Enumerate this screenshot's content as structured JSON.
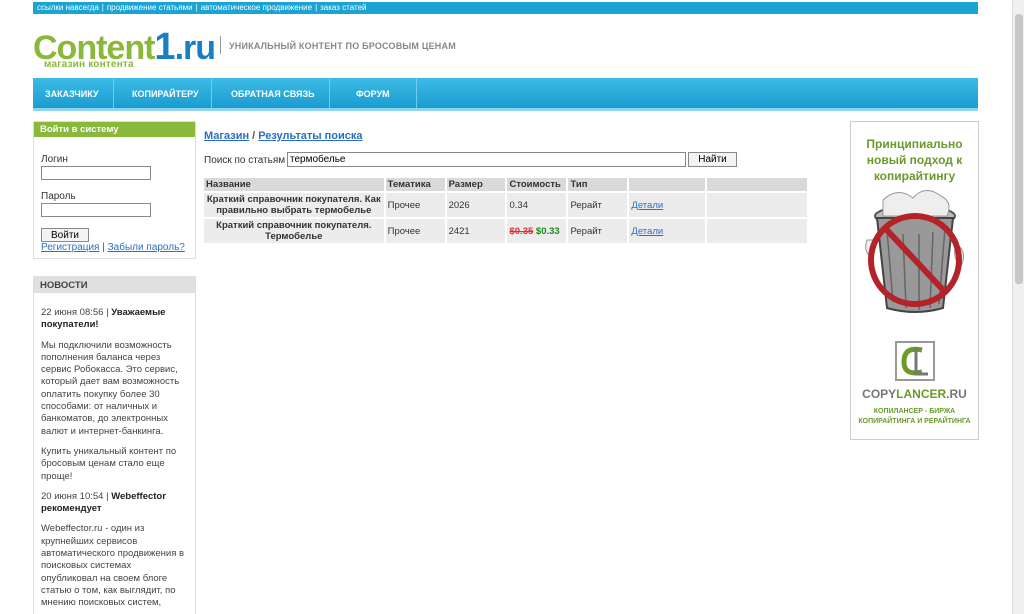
{
  "topbar": {
    "links": [
      "ссылки навсегда",
      "продвижение статьями",
      "автоматическое продвижение",
      "заказ статей"
    ]
  },
  "header": {
    "logo_text_main": "Content",
    "logo_text_num": "1",
    "logo_text_ru": ".ru",
    "logo_sub": "магазин контента",
    "slogan": "УНИКАЛЬНЫЙ КОНТЕНТ ПО БРОСОВЫМ ЦЕНАМ"
  },
  "nav": {
    "items": [
      "ЗАКАЗЧИКУ",
      "КОПИРАЙТЕРУ",
      "ОБРАТНАЯ СВЯЗЬ",
      "ФОРУМ"
    ]
  },
  "login": {
    "title": "Войти в систему",
    "login_label": "Логин",
    "password_label": "Пароль",
    "login_value": "",
    "password_value": "",
    "submit_label": "Войти",
    "register_link": "Регистрация",
    "separator": "|",
    "forgot_link": "Забыли пароль?"
  },
  "news": {
    "title": "НОВОСТИ",
    "items": [
      {
        "date": "22 июня 08:56",
        "sep": " | ",
        "headline": "Уважаемые покупатели!"
      },
      {
        "text": "Мы подключили возможность пополнения баланса через сервис Робокасса. Это сервис, который дает вам возможность оплатить покупку более 30 способами: от наличных и банкоматов, до электронных валют и интернет-банкинга."
      },
      {
        "text": "Купить уникальный контент по бросовым ценам стало еще проще!"
      },
      {
        "date": "20 июня 10:54",
        "sep": " | ",
        "headline": "Webeffector рекомендует"
      },
      {
        "text": "Webeffector.ru - один из крупнейших сервисов автоматического продвижения в поисковых системах опубликовал на своем блоге статью о том, как выглядит, по мнению поисковых систем,"
      }
    ]
  },
  "main": {
    "breadcrumb_root": "Магазин",
    "breadcrumb_sep": "/",
    "breadcrumb_current": "Результаты поиска",
    "search_label": "Поиск по статьям",
    "search_value": "термобелье",
    "search_button": "Найти",
    "table": {
      "headers": [
        "Название",
        "Тематика",
        "Размер",
        "Стоимость",
        "Тип",
        ""
      ],
      "rows": [
        {
          "name": "Краткий справочник покупателя. Как правильно выбрать термобелье",
          "topic": "Прочее",
          "size": "2026",
          "price": "0.34",
          "old_price": "",
          "type": "Рерайт",
          "link": "Детали"
        },
        {
          "name": "Краткий справочник покупателя. Термобелье",
          "topic": "Прочее",
          "size": "2421",
          "price": "$0.33",
          "old_price": "$0.35",
          "type": "Рерайт",
          "link": "Детали"
        }
      ]
    }
  },
  "ad": {
    "headline": "Принципиально новый подход к копирайтингу",
    "brand_a": "COPY",
    "brand_b": "LANCER",
    "brand_c": ".RU",
    "tagline": "КОПИЛАНСЕР - БИРЖА КОПИРАЙТИНГА И РЕРАЙТИНГА",
    "colors": {
      "green": "#6a9a2a",
      "red": "#b5232a"
    }
  },
  "colors": {
    "accent_blue": "#1ba3d4",
    "accent_green": "#8ab83a",
    "link": "#2a6fc0"
  }
}
